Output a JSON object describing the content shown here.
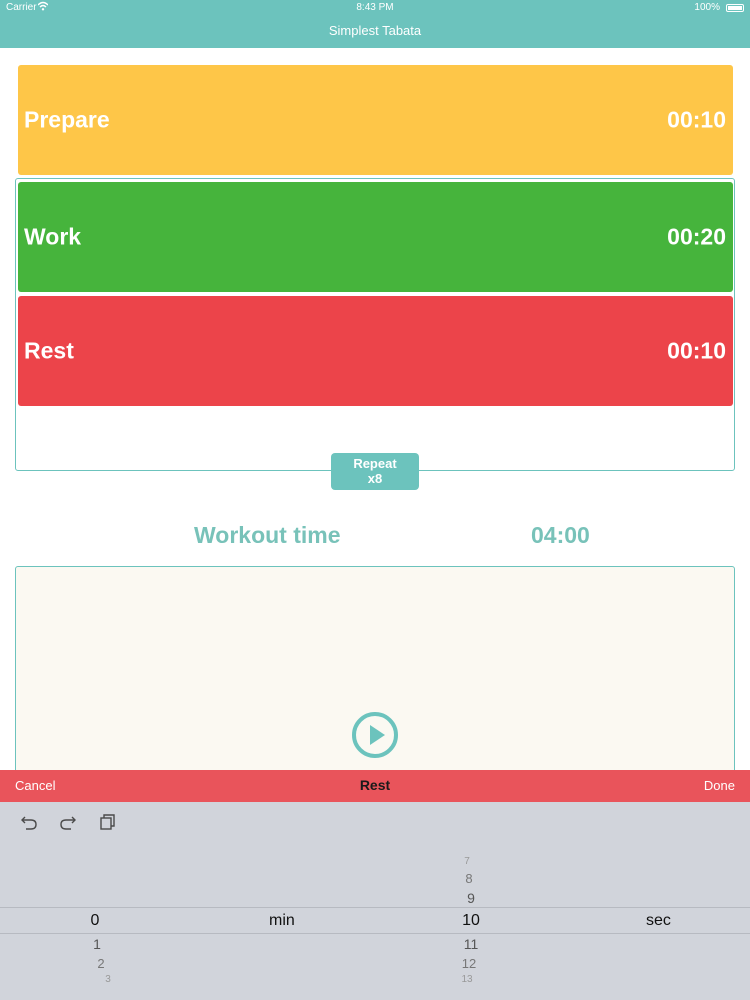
{
  "status_bar": {
    "carrier": "Carrier",
    "time": "8:43 PM",
    "battery": "100%"
  },
  "app": {
    "title": "Simplest Tabata"
  },
  "phases": [
    {
      "label": "Prepare",
      "time": "00:10",
      "color": "#fec648"
    },
    {
      "label": "Work",
      "time": "00:20",
      "color": "#46b43c"
    },
    {
      "label": "Rest",
      "time": "00:10",
      "color": "#ec444a"
    }
  ],
  "repeat": {
    "label": "Repeat",
    "count": "x8"
  },
  "workout": {
    "label": "Workout time",
    "value": "04:00"
  },
  "picker": {
    "cancel": "Cancel",
    "title": "Rest",
    "done": "Done",
    "minutes": {
      "above": [],
      "selected": "0",
      "below": [
        "1",
        "2",
        "3"
      ]
    },
    "min_unit": "min",
    "seconds": {
      "above": [
        "7",
        "8",
        "9"
      ],
      "selected": "10",
      "below": [
        "11",
        "12",
        "13"
      ]
    },
    "sec_unit": "sec"
  },
  "toolbar_icons": [
    "undo-icon",
    "redo-icon",
    "paste-icon"
  ],
  "colors": {
    "accent": "#6cc3bd",
    "prepare": "#fec648",
    "work": "#46b43c",
    "rest": "#ec444a",
    "picker_bar": "#e9545b"
  }
}
